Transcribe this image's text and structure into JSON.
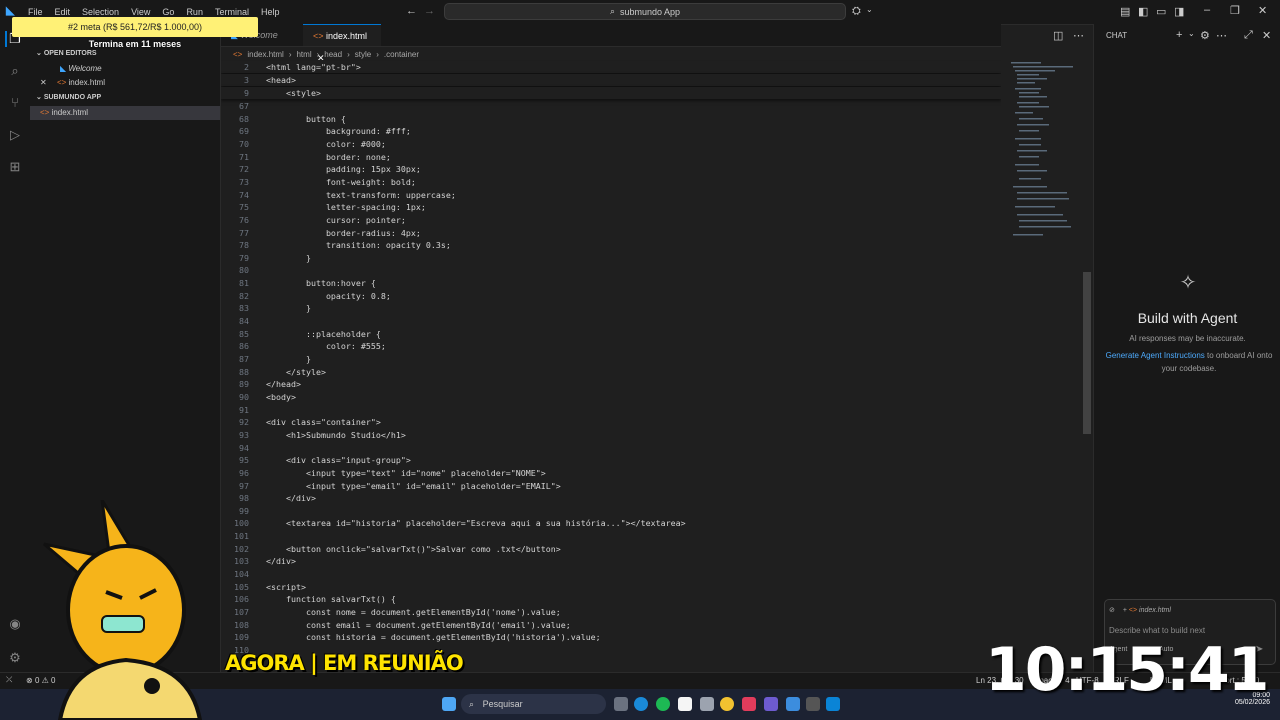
{
  "menu": [
    "File",
    "Edit",
    "Selection",
    "View",
    "Go",
    "Run",
    "Terminal",
    "Help"
  ],
  "command_center": {
    "text": "submundo App"
  },
  "overlay": {
    "goal": "#2 meta (R$ 561,72/R$ 1.000,00)",
    "goal_sub": "Termina em 11 meses",
    "meeting": "AGORA | EM REUNIÃO",
    "clock": "10:15:41"
  },
  "sidebar": {
    "open_editors_label": "OPEN EDITORS",
    "open_editors": [
      {
        "label": "Welcome",
        "italic": true
      },
      {
        "label": "index.html",
        "italic": false
      }
    ],
    "project_label": "SUBMUNDO APP",
    "files": [
      {
        "label": "index.html"
      }
    ]
  },
  "tabs": [
    {
      "label": "Welcome",
      "active": false
    },
    {
      "label": "index.html",
      "active": true
    }
  ],
  "breadcrumb": [
    "index.html",
    "html",
    "head",
    "style",
    ".container"
  ],
  "editor": {
    "sticky": [
      {
        "n": "2",
        "t": "<html lang=\"pt-br\">"
      },
      {
        "n": "3",
        "t": "<head>"
      },
      {
        "n": "9",
        "t": "    <style>"
      }
    ],
    "lines": [
      {
        "n": "67",
        "t": ""
      },
      {
        "n": "68",
        "t": "        button {"
      },
      {
        "n": "69",
        "t": "            background: #fff;"
      },
      {
        "n": "70",
        "t": "            color: #000;"
      },
      {
        "n": "71",
        "t": "            border: none;"
      },
      {
        "n": "72",
        "t": "            padding: 15px 30px;"
      },
      {
        "n": "73",
        "t": "            font-weight: bold;"
      },
      {
        "n": "74",
        "t": "            text-transform: uppercase;"
      },
      {
        "n": "75",
        "t": "            letter-spacing: 1px;"
      },
      {
        "n": "76",
        "t": "            cursor: pointer;"
      },
      {
        "n": "77",
        "t": "            border-radius: 4px;"
      },
      {
        "n": "78",
        "t": "            transition: opacity 0.3s;"
      },
      {
        "n": "79",
        "t": "        }"
      },
      {
        "n": "80",
        "t": ""
      },
      {
        "n": "81",
        "t": "        button:hover {"
      },
      {
        "n": "82",
        "t": "            opacity: 0.8;"
      },
      {
        "n": "83",
        "t": "        }"
      },
      {
        "n": "84",
        "t": ""
      },
      {
        "n": "85",
        "t": "        ::placeholder {"
      },
      {
        "n": "86",
        "t": "            color: #555;"
      },
      {
        "n": "87",
        "t": "        }"
      },
      {
        "n": "88",
        "t": "    </style>"
      },
      {
        "n": "89",
        "t": "</head>"
      },
      {
        "n": "90",
        "t": "<body>"
      },
      {
        "n": "91",
        "t": ""
      },
      {
        "n": "92",
        "t": "<div class=\"container\">"
      },
      {
        "n": "93",
        "t": "    <h1>Submundo Studio</h1>"
      },
      {
        "n": "94",
        "t": ""
      },
      {
        "n": "95",
        "t": "    <div class=\"input-group\">"
      },
      {
        "n": "96",
        "t": "        <input type=\"text\" id=\"nome\" placeholder=\"NOME\">"
      },
      {
        "n": "97",
        "t": "        <input type=\"email\" id=\"email\" placeholder=\"EMAIL\">"
      },
      {
        "n": "98",
        "t": "    </div>"
      },
      {
        "n": "99",
        "t": ""
      },
      {
        "n": "100",
        "t": "    <textarea id=\"historia\" placeholder=\"Escreva aqui a sua história...\"></textarea>"
      },
      {
        "n": "101",
        "t": ""
      },
      {
        "n": "102",
        "t": "    <button onclick=\"salvarTxt()\">Salvar como .txt</button>"
      },
      {
        "n": "103",
        "t": "</div>"
      },
      {
        "n": "104",
        "t": ""
      },
      {
        "n": "105",
        "t": "<script>"
      },
      {
        "n": "106",
        "t": "    function salvarTxt() {"
      },
      {
        "n": "107",
        "t": "        const nome = document.getElementById('nome').value;"
      },
      {
        "n": "108",
        "t": "        const email = document.getElementById('email').value;"
      },
      {
        "n": "109",
        "t": "        const historia = document.getElementById('historia').value;"
      },
      {
        "n": "110",
        "t": ""
      }
    ]
  },
  "chat": {
    "title": "CHAT",
    "heading": "Build with Agent",
    "subtitle": "AI responses may be inaccurate.",
    "link": "Generate Agent Instructions",
    "link_rest": "to onboard AI onto your codebase.",
    "context_file": "index.html",
    "input_placeholder": "Describe what to build next",
    "mode": "Agent",
    "model": "Auto"
  },
  "status": {
    "errors": "0",
    "warnings": "0",
    "position": "Ln 23, Col 30",
    "spaces": "Spaces: 4",
    "encoding": "UTF-8",
    "eol": "CRLF",
    "language": "HTML",
    "port": "Port : 5500"
  },
  "taskbar": {
    "search": "Pesquisar",
    "time": "09:00",
    "date": "05/02/2026"
  },
  "colors": {
    "accent": "#0078d4",
    "goal_bg": "#fff176",
    "meeting": "#ffe400"
  }
}
